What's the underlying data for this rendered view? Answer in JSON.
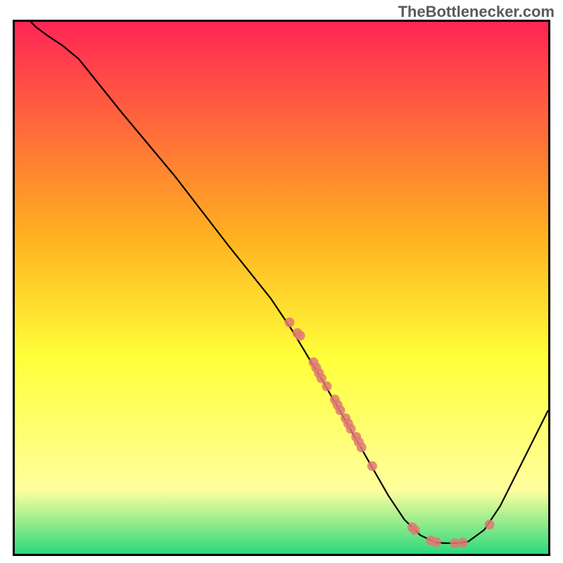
{
  "watermark": "TheBottlenecker.com",
  "chart_data": {
    "type": "line",
    "title": "",
    "xlabel": "",
    "ylabel": "",
    "xlim": [
      0,
      100
    ],
    "ylim": [
      0,
      100
    ],
    "background_gradient": {
      "top": "#ff2555",
      "mid1": "#ffb020",
      "mid2": "#ffff3a",
      "mid3": "#ffff9e",
      "bottom": "#2cd97b"
    },
    "curve": [
      {
        "x": 3,
        "y": 100
      },
      {
        "x": 4,
        "y": 99
      },
      {
        "x": 6,
        "y": 97.5
      },
      {
        "x": 9,
        "y": 95.5
      },
      {
        "x": 12,
        "y": 93
      },
      {
        "x": 20,
        "y": 83
      },
      {
        "x": 30,
        "y": 71
      },
      {
        "x": 40,
        "y": 58
      },
      {
        "x": 48,
        "y": 48
      },
      {
        "x": 52,
        "y": 42
      },
      {
        "x": 55,
        "y": 37
      },
      {
        "x": 58,
        "y": 32
      },
      {
        "x": 62,
        "y": 25
      },
      {
        "x": 66,
        "y": 18
      },
      {
        "x": 70,
        "y": 11
      },
      {
        "x": 73,
        "y": 6.5
      },
      {
        "x": 76,
        "y": 3.5
      },
      {
        "x": 79,
        "y": 2.1
      },
      {
        "x": 81,
        "y": 2.0
      },
      {
        "x": 83,
        "y": 2.0
      },
      {
        "x": 85,
        "y": 2.3
      },
      {
        "x": 88,
        "y": 4.5
      },
      {
        "x": 91,
        "y": 9
      },
      {
        "x": 95,
        "y": 17
      },
      {
        "x": 100,
        "y": 27
      }
    ],
    "markers": [
      {
        "x": 51.5,
        "y": 43.5
      },
      {
        "x": 53,
        "y": 41.5
      },
      {
        "x": 53.5,
        "y": 41
      },
      {
        "x": 56,
        "y": 36
      },
      {
        "x": 56.5,
        "y": 35
      },
      {
        "x": 57,
        "y": 34
      },
      {
        "x": 57.5,
        "y": 33
      },
      {
        "x": 58.5,
        "y": 31.5
      },
      {
        "x": 60,
        "y": 29
      },
      {
        "x": 60.5,
        "y": 28
      },
      {
        "x": 61,
        "y": 27
      },
      {
        "x": 62,
        "y": 25.5
      },
      {
        "x": 62.5,
        "y": 24.5
      },
      {
        "x": 63,
        "y": 23.5
      },
      {
        "x": 64,
        "y": 22
      },
      {
        "x": 64.5,
        "y": 21
      },
      {
        "x": 65,
        "y": 20
      },
      {
        "x": 67,
        "y": 16.5
      },
      {
        "x": 74.5,
        "y": 5
      },
      {
        "x": 75,
        "y": 4.5
      },
      {
        "x": 78,
        "y": 2.5
      },
      {
        "x": 79,
        "y": 2.2
      },
      {
        "x": 82.5,
        "y": 2.0
      },
      {
        "x": 84,
        "y": 2.1
      },
      {
        "x": 89,
        "y": 5.5
      }
    ]
  }
}
